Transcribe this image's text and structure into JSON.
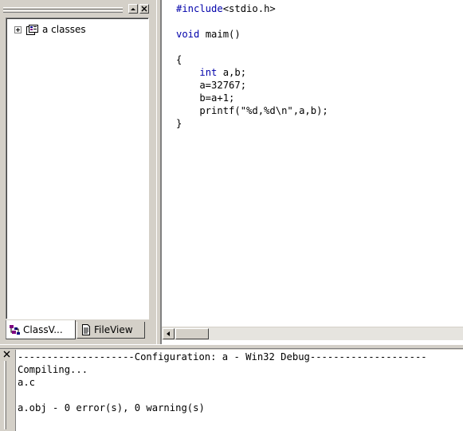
{
  "workspace": {
    "tree": {
      "root_label": "a classes",
      "root_icon": "class-folder-icon"
    },
    "tabs": [
      {
        "label": "ClassV...",
        "icon": "classview-icon"
      },
      {
        "label": "FileView",
        "icon": "fileview-icon"
      }
    ],
    "header_buttons": {
      "restore": "restore-icon",
      "close": "close-icon"
    }
  },
  "editor": {
    "lines": [
      {
        "parts": [
          {
            "t": "#include",
            "kw": true
          },
          {
            "t": "<stdio.h>"
          }
        ]
      },
      {
        "parts": [
          {
            "t": ""
          }
        ]
      },
      {
        "parts": [
          {
            "t": "void",
            "kw": true
          },
          {
            "t": " maim()"
          }
        ]
      },
      {
        "parts": [
          {
            "t": ""
          }
        ]
      },
      {
        "parts": [
          {
            "t": "{"
          }
        ]
      },
      {
        "parts": [
          {
            "t": "    "
          },
          {
            "t": "int",
            "kw": true
          },
          {
            "t": " a,b;"
          }
        ]
      },
      {
        "parts": [
          {
            "t": "    a=32767;"
          }
        ]
      },
      {
        "parts": [
          {
            "t": "    b=a+1;"
          }
        ]
      },
      {
        "parts": [
          {
            "t": "    printf(\"%d,%d\\n\",a,b);"
          }
        ]
      },
      {
        "parts": [
          {
            "t": "}"
          }
        ]
      }
    ],
    "keyword_color": "#0000aa"
  },
  "output": {
    "lines": [
      "--------------------Configuration: a - Win32 Debug--------------------",
      "Compiling...",
      "a.c",
      "",
      "a.obj - 0 error(s), 0 warning(s)"
    ]
  }
}
